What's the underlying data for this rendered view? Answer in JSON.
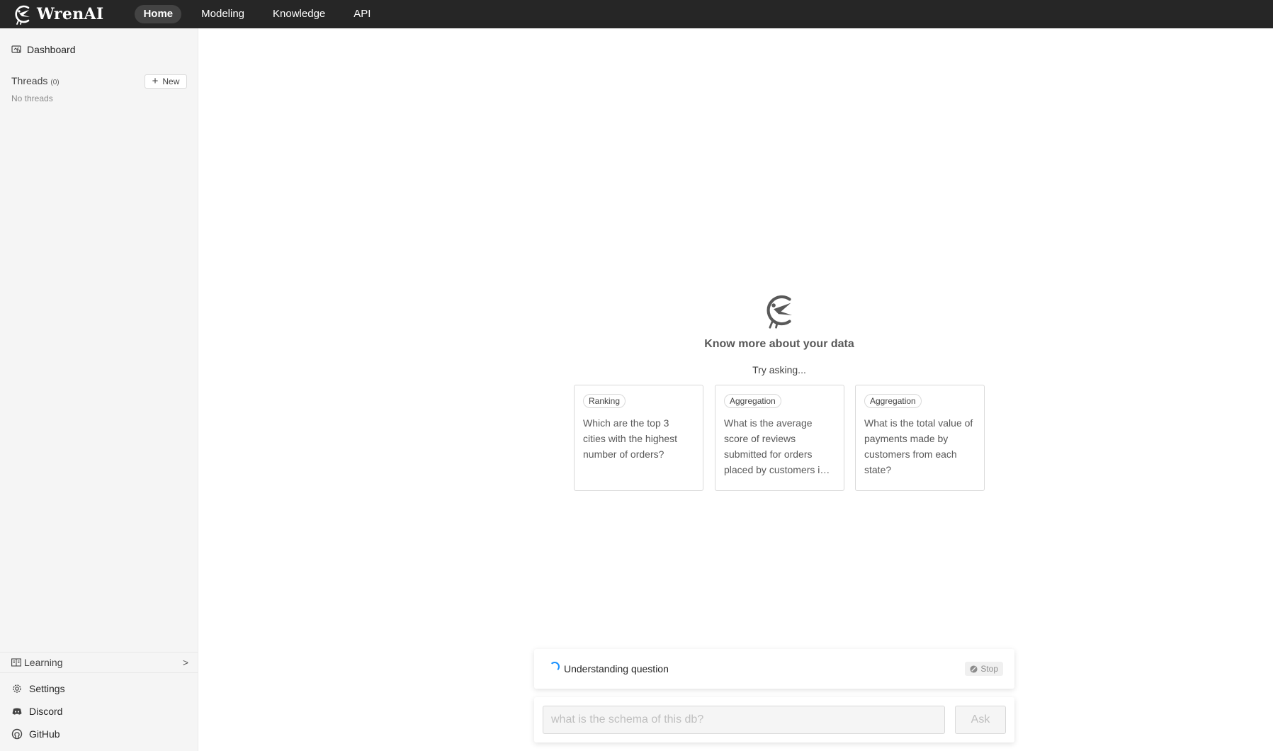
{
  "app": {
    "name": "WrenAI"
  },
  "nav": {
    "items": [
      {
        "label": "Home",
        "active": true
      },
      {
        "label": "Modeling",
        "active": false
      },
      {
        "label": "Knowledge",
        "active": false
      },
      {
        "label": "API",
        "active": false
      }
    ]
  },
  "sidebar": {
    "dashboard_label": "Dashboard",
    "threads_label": "Threads",
    "threads_count": "(0)",
    "new_label": "New",
    "empty_label": "No threads",
    "learning_label": "Learning",
    "links": [
      {
        "label": "Settings",
        "icon": "gear-icon"
      },
      {
        "label": "Discord",
        "icon": "discord-icon"
      },
      {
        "label": "GitHub",
        "icon": "github-icon"
      }
    ]
  },
  "main": {
    "title": "Know more about your data",
    "try_label": "Try asking...",
    "suggestions": [
      {
        "tag": "Ranking",
        "question": "Which are the top 3 cities with the highest number of orders?"
      },
      {
        "tag": "Aggregation",
        "question": "What is the average score of reviews submitted for orders placed by customers in each city?"
      },
      {
        "tag": "Aggregation",
        "question": "What is the total value of payments made by customers from each state?"
      }
    ]
  },
  "status": {
    "text": "Understanding question",
    "stop_label": "Stop"
  },
  "ask": {
    "placeholder": "what is the schema of this db?",
    "button_label": "Ask"
  },
  "colors": {
    "topbar": "#262626",
    "sidebar": "#f5f5f5",
    "accent": "#1890ff"
  }
}
